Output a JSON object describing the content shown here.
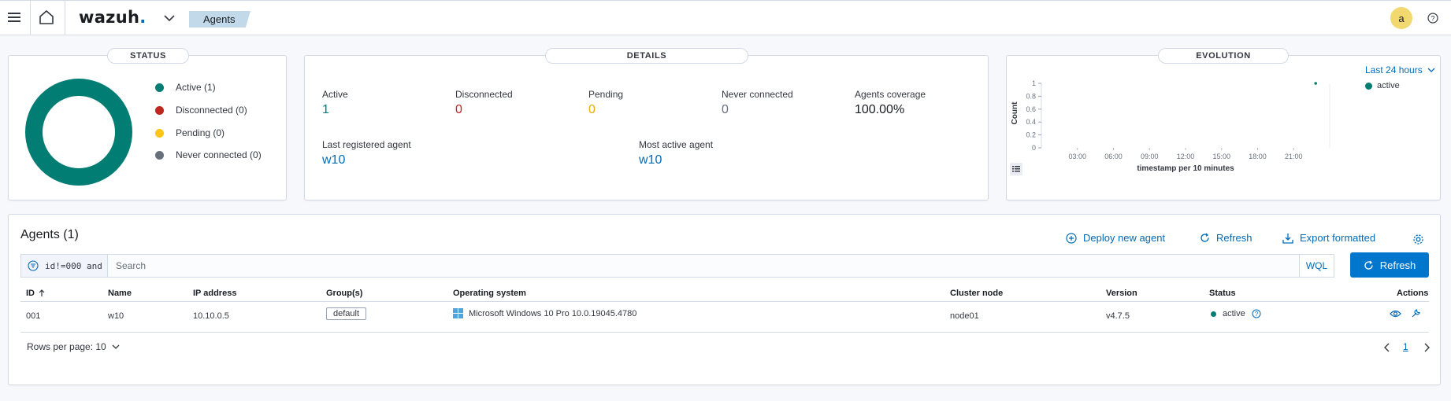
{
  "header": {
    "logo_text": "wazuh",
    "logo_dot": ".",
    "breadcrumb": "Agents",
    "avatar_initial": "a",
    "icons": [
      "menu-icon",
      "home-icon",
      "chevron-down-icon",
      "help-icon"
    ]
  },
  "status_panel": {
    "title": "STATUS",
    "legend": [
      {
        "label": "Active (1)",
        "color": "#017d73"
      },
      {
        "label": "Disconnected (0)",
        "color": "#bd271e"
      },
      {
        "label": "Pending (0)",
        "color": "#fec514"
      },
      {
        "label": "Never connected (0)",
        "color": "#69707d"
      }
    ],
    "donut_color": "#017d73"
  },
  "details_panel": {
    "title": "DETAILS",
    "stats": [
      {
        "label": "Active",
        "value": "1",
        "color": "#017d73"
      },
      {
        "label": "Disconnected",
        "value": "0",
        "color": "#bd271e"
      },
      {
        "label": "Pending",
        "value": "0",
        "color": "#fec514"
      },
      {
        "label": "Never connected",
        "value": "0",
        "color": "#69707d"
      },
      {
        "label": "Agents coverage",
        "value": "100.00%",
        "color": "#1a1c21"
      }
    ],
    "last_registered_label": "Last registered agent",
    "last_registered_value": "w10",
    "most_active_label": "Most active agent",
    "most_active_value": "w10"
  },
  "evolution_panel": {
    "title": "EVOLUTION",
    "range": "Last 24 hours",
    "chart_data": {
      "type": "line",
      "xlabel": "timestamp per 10 minutes",
      "ylabel": "Count",
      "x_ticks": [
        "03:00",
        "06:00",
        "09:00",
        "12:00",
        "15:00",
        "18:00",
        "21:00"
      ],
      "y_ticks": [
        "1",
        "0.8",
        "0.6",
        "0.4",
        "0.2",
        "0"
      ],
      "ylim": [
        0,
        1
      ],
      "series": [
        {
          "name": "active",
          "color": "#017d73",
          "points": [
            {
              "x": "22:50",
              "y": 1
            }
          ]
        }
      ],
      "legend_position": "top-right"
    }
  },
  "agents_panel": {
    "title": "Agents (1)",
    "actions": {
      "deploy": "Deploy new agent",
      "refresh": "Refresh",
      "export": "Export formatted"
    },
    "search": {
      "filter_query": "id!=000 and",
      "placeholder": "Search",
      "wql": "WQL",
      "refresh_button": "Refresh"
    },
    "columns": [
      "ID",
      "Name",
      "IP address",
      "Group(s)",
      "Operating system",
      "Cluster node",
      "Version",
      "Status",
      "Actions"
    ],
    "rows": [
      {
        "id": "001",
        "name": "w10",
        "ip": "10.10.0.5",
        "group": "default",
        "os": "Microsoft Windows 10 Pro 10.0.19045.4780",
        "cluster_node": "node01",
        "version": "v4.7.5",
        "status": "active"
      }
    ],
    "pagination": {
      "rows_per_page": "Rows per page: 10",
      "current_page": "1"
    }
  }
}
